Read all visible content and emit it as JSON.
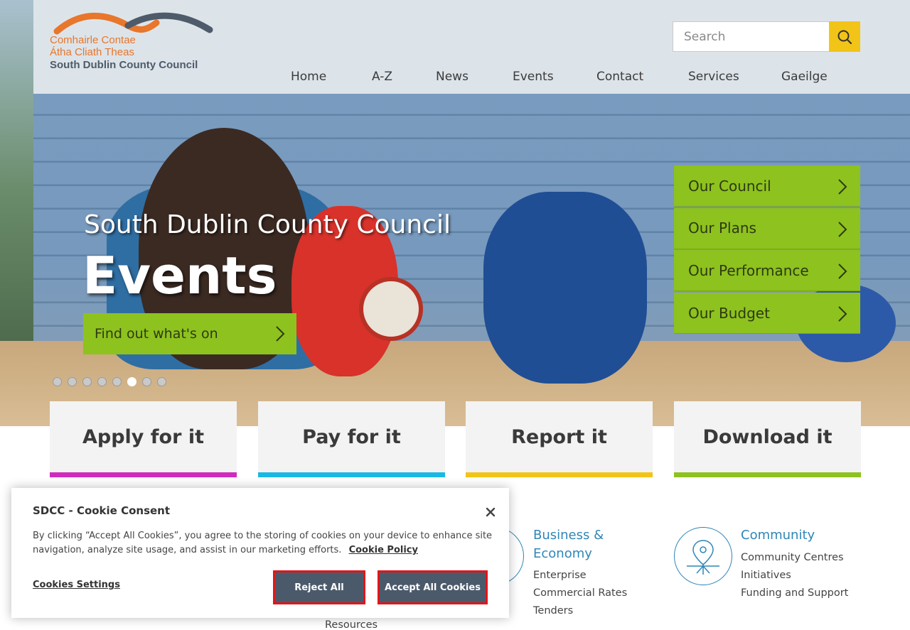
{
  "header": {
    "logo": {
      "line1": "Comhairle Contae",
      "line2": "Átha Cliath Theas",
      "line3": "South Dublin County Council"
    },
    "search": {
      "placeholder": "Search"
    },
    "nav": [
      "Home",
      "A-Z",
      "News",
      "Events",
      "Contact",
      "Services",
      "Gaeilge"
    ]
  },
  "hero": {
    "subtitle": "South Dublin County Council",
    "title": "Events",
    "cta_label": "Find out what's on",
    "carousel": {
      "count": 8,
      "active_index": 5
    },
    "side_menu": [
      "Our Council",
      "Our Plans",
      "Our Performance",
      "Our Budget"
    ]
  },
  "actions": [
    {
      "label": "Apply for it",
      "color": "#d02bbd"
    },
    {
      "label": "Pay for it",
      "color": "#1ab8e5"
    },
    {
      "label": "Report it",
      "color": "#f2c417"
    },
    {
      "label": "Download it",
      "color": "#8dc21f"
    }
  ],
  "categories": {
    "business": {
      "title": "Business & Economy",
      "links": [
        "Enterprise",
        "Commercial Rates",
        "Tenders"
      ]
    },
    "community": {
      "title": "Community",
      "links": [
        "Community Centres",
        "Initiatives",
        "Funding and Support"
      ]
    },
    "partial_link": "Resources"
  },
  "cookie_banner": {
    "title": "SDCC - Cookie Consent",
    "text": "By clicking “Accept All Cookies”, you agree to the storing of cookies on your device to enhance site navigation, analyze site usage, and assist in our marketing efforts.",
    "policy_link": "Cookie Policy",
    "settings_link": "Cookies Settings",
    "reject_label": "Reject All",
    "accept_label": "Accept All Cookies"
  },
  "colors": {
    "accent_green": "#8dc21f",
    "accent_yellow": "#f2c417",
    "link_blue": "#2f86b8",
    "button_slate": "#4b5a6b",
    "logo_orange": "#e8762b"
  },
  "icons": [
    "search-icon",
    "chevron-right-icon",
    "close-icon",
    "map-pin-icon",
    "document-icon"
  ]
}
